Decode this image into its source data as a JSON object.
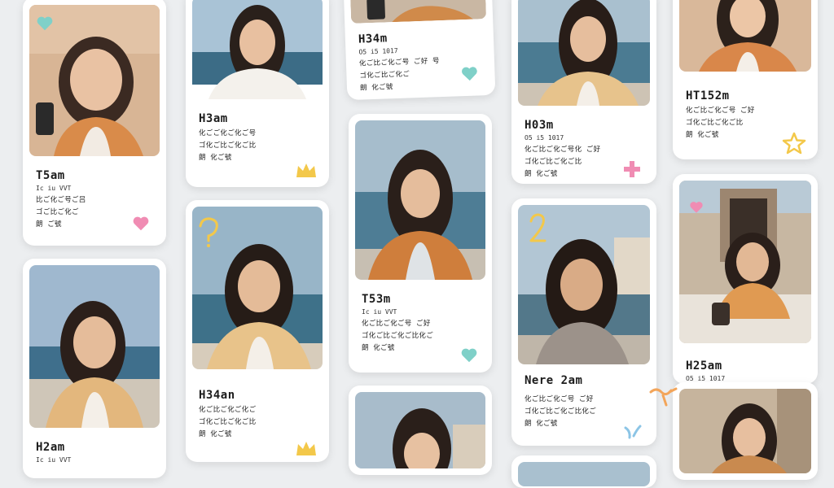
{
  "background": "#eceef0",
  "accents": {
    "teal": "#7fd0c8",
    "pink": "#f08cb3",
    "yellow": "#f3c84a",
    "orange": "#f3a55a",
    "blue": "#8cc5e6"
  },
  "cards": [
    {
      "name": "T5am",
      "sub": "Ic iu VVT",
      "lines": [
        "比ご化ご号ご吕",
        "ゴご比ご化ご",
        "朗 ご號"
      ],
      "icon": "heart-icon"
    },
    {
      "name": "H2am",
      "sub": "Ic iu VVT",
      "lines": []
    },
    {
      "name": "",
      "sub": "",
      "lines": [],
      "icon": "heart-icon"
    },
    {
      "name": "H3am",
      "sub": "",
      "lines": [
        "化ごご化ご化ご号",
        "ゴ化ご比ご化ご比",
        "朗 化ご號"
      ],
      "icon": "crown-icon"
    },
    {
      "name": "H34an",
      "sub": "",
      "lines": [
        "化ご比ご化ご化ご",
        "ゴ化ご比ご化ご比",
        "朗 化ご號"
      ],
      "icon": "crown-icon"
    },
    {
      "name": "H34m",
      "sub": "O5 i5 1017",
      "lines": [
        "化ご比ご化ご号 ご好 号",
        "ゴ化ご比ご化ご",
        "朗 化ご號"
      ],
      "icon": "heart-icon"
    },
    {
      "name": "T53m",
      "sub": "Ic iu VVT",
      "lines": [
        "化ご比ご化ご号 ご好",
        "ゴ化ご比ご化ご比化ご",
        "朗 化ご號"
      ],
      "icon": "heart-icon"
    },
    {
      "name": "H03m",
      "sub": "O5 i5 1017",
      "lines": [
        "化ご比ご化ご号化 ご好",
        "ゴ化ご比ご化ご比",
        "朗 化ご號"
      ],
      "icon": "plus-icon"
    },
    {
      "name": "Nere 2am",
      "sub": "",
      "lines": [
        "化ご比ご化ご号 ご好",
        "ゴ化ご比ご化ご比化ご",
        "朗 化ご號"
      ],
      "icon": "sparkle-icon"
    },
    {
      "name": "HT152m",
      "sub": "",
      "lines": [
        "化ご比ご化ご号 ご好",
        "ゴ化ご比ご化ご比",
        "朗 化ご號"
      ],
      "icon": "star-icon"
    },
    {
      "name": "H25am",
      "sub": "O5 i5 1017",
      "lines": []
    }
  ],
  "doodles": [
    "question-doodle-icon",
    "number-two-doodle-icon",
    "squiggle-doodle-icon"
  ]
}
